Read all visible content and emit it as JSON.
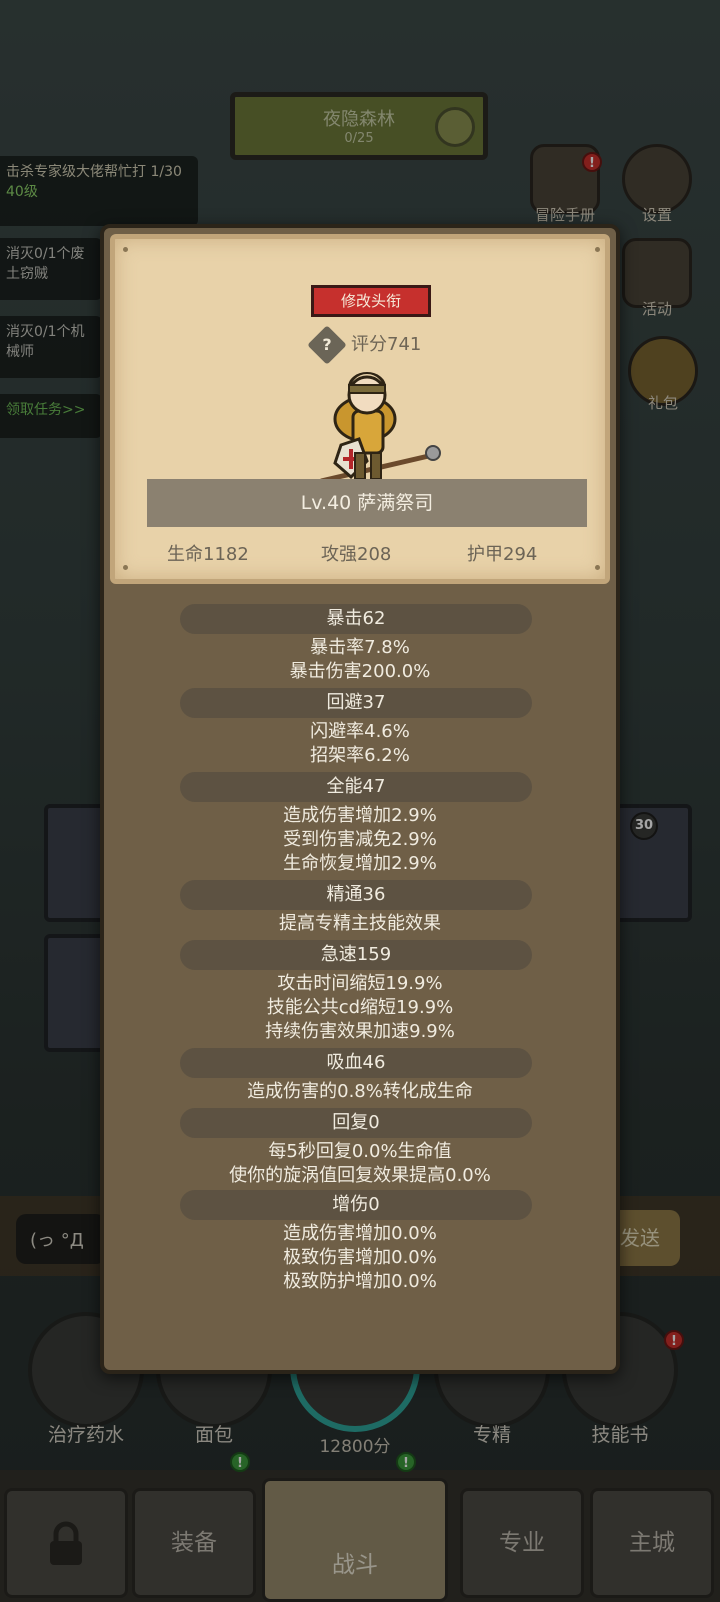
{
  "background": {
    "map": {
      "name": "夜隐森林",
      "sub": "0/25"
    },
    "quests": [
      {
        "text": "击杀专家级大佬帮忙打 1/30",
        "level": "40级"
      },
      {
        "text": "消灭0/1个废土窃贼"
      },
      {
        "text": "消灭0/1个机械师"
      },
      {
        "text": "领取任务>>"
      }
    ],
    "side": [
      {
        "label": "冒险手册",
        "badge": "!"
      },
      {
        "label": "设置"
      },
      {
        "label": "活动"
      },
      {
        "label": "礼包"
      }
    ],
    "slot_level": "30",
    "chat": {
      "input": "(っ °Д",
      "send": "发送"
    },
    "consumables": [
      "治疗药水",
      "面包",
      "专精",
      "技能书"
    ],
    "score_label": "12800分",
    "nav": [
      "",
      "装备",
      "战斗",
      "专业",
      "主城"
    ],
    "badge": "!"
  },
  "profile": {
    "title_button": "修改头衔",
    "help": "?",
    "score": "评分741",
    "name_line": "Lv.40 萨满祭司",
    "primary": [
      "生命1182",
      "攻强208",
      "护甲294"
    ]
  },
  "stats": [
    {
      "header": "暴击62",
      "lines": [
        "暴击率7.8%",
        "暴击伤害200.0%"
      ]
    },
    {
      "header": "回避37",
      "lines": [
        "闪避率4.6%",
        "招架率6.2%"
      ]
    },
    {
      "header": "全能47",
      "lines": [
        "造成伤害增加2.9%",
        "受到伤害减免2.9%",
        "生命恢复增加2.9%"
      ]
    },
    {
      "header": "精通36",
      "lines": [
        "提高专精主技能效果"
      ]
    },
    {
      "header": "急速159",
      "lines": [
        "攻击时间缩短19.9%",
        "技能公共cd缩短19.9%",
        "持续伤害效果加速9.9%"
      ]
    },
    {
      "header": "吸血46",
      "lines": [
        "造成伤害的0.8%转化成生命"
      ]
    },
    {
      "header": "回复0",
      "lines": [
        "每5秒回复0.0%生命值",
        "使你的旋涡值回复效果提高0.0%"
      ]
    },
    {
      "header": "增伤0",
      "lines": [
        "造成伤害增加0.0%",
        "极致伤害增加0.0%",
        "极致防护增加0.0%"
      ]
    }
  ]
}
